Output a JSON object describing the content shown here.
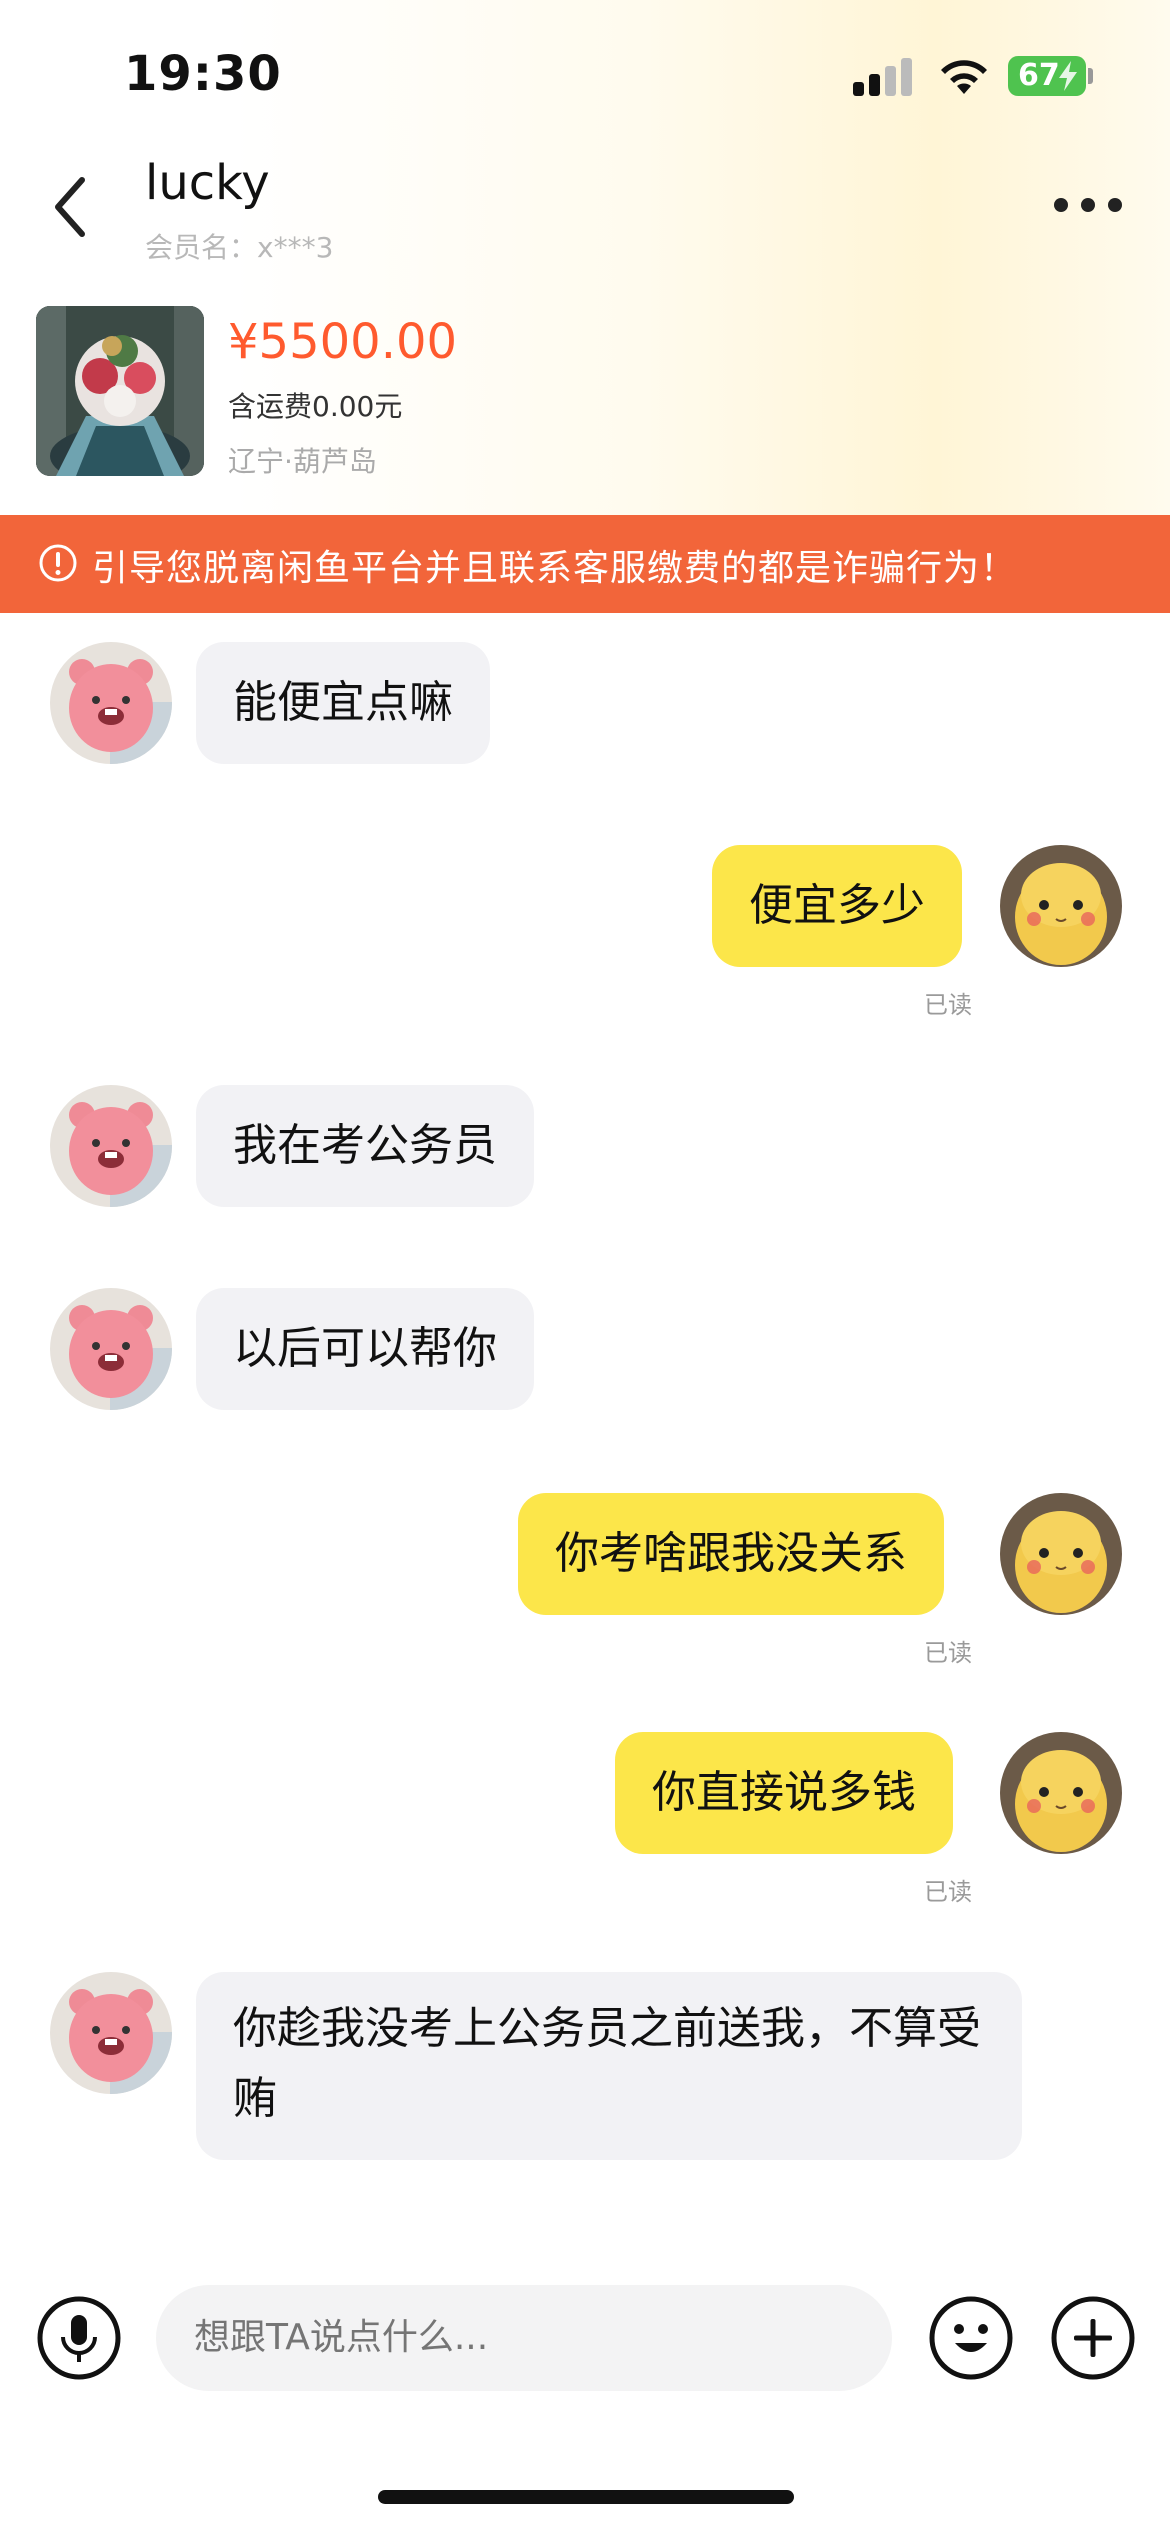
{
  "status_bar": {
    "time": "19:30",
    "battery": "67"
  },
  "header": {
    "name": "lucky",
    "member_label": "会员名：x***3"
  },
  "product": {
    "price": "¥5500.00",
    "shipping": "含运费0.00元",
    "location": "辽宁·葫芦岛"
  },
  "warning": {
    "text": "引导您脱离闲鱼平台并且联系客服缴费的都是诈骗行为！"
  },
  "messages": [
    {
      "side": "in",
      "text": "能便宜点嘛"
    },
    {
      "side": "out",
      "text": "便宜多少",
      "status": "已读"
    },
    {
      "side": "in",
      "text": "我在考公务员"
    },
    {
      "side": "in",
      "text": "以后可以帮你"
    },
    {
      "side": "out",
      "text": "你考啥跟我没关系",
      "status": "已读"
    },
    {
      "side": "out",
      "text": "你直接说多钱",
      "status": "已读"
    },
    {
      "side": "in",
      "text": "你趁我没考上公务员之前送我，不算受贿"
    }
  ],
  "input": {
    "placeholder": "想跟TA说点什么..."
  },
  "icons": {
    "back": "chevron-left-icon",
    "more": "more-dots-icon",
    "warning": "alert-circle-icon",
    "mic": "microphone-icon",
    "emoji": "emoji-icon",
    "plus": "plus-icon"
  },
  "colors": {
    "accent_price": "#ff5a2e",
    "warning_bg": "#f2653a",
    "outgoing_bubble": "#fce64a",
    "incoming_bubble": "#f2f2f5"
  }
}
